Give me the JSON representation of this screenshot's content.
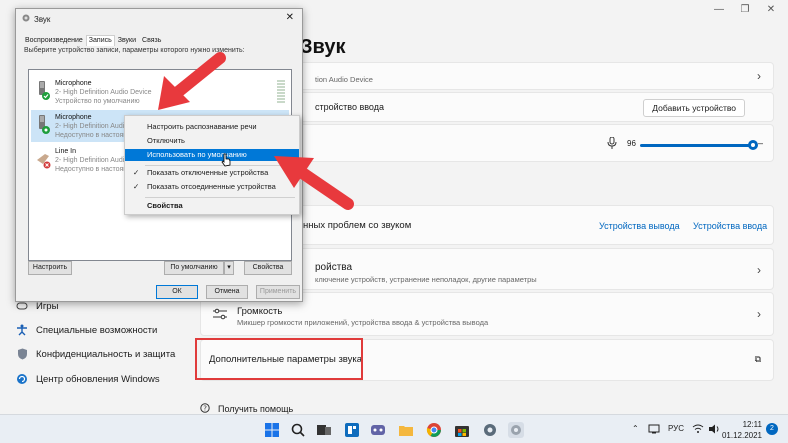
{
  "settings": {
    "title": "Звук",
    "row1": {
      "title_fragment": "",
      "sub": "tion Audio Device"
    },
    "row2": {
      "label": "стройство ввода",
      "button": "Добавить устройство"
    },
    "volume": {
      "value": "96",
      "level": 0.96
    },
    "troubleshoot": {
      "label": "нных проблем со звуком",
      "link_out": "Устройства вывода",
      "link_in": "Устройства ввода"
    },
    "devices": {
      "title": "ройства",
      "sub": "ключение устройств, устранение неполадок, другие параметры"
    },
    "mixer": {
      "title": "Громкость",
      "sub": "Микшер громкости приложений, устройства ввода & устройства вывода"
    },
    "advanced": {
      "label": "Дополнительные параметры звука"
    },
    "help": "Получить помощь",
    "nav": [
      {
        "label": "Игры",
        "icon": "gamepad-icon"
      },
      {
        "label": "Специальные возможности",
        "icon": "accessibility-icon"
      },
      {
        "label": "Конфиденциальность и защита",
        "icon": "shield-icon"
      },
      {
        "label": "Центр обновления Windows",
        "icon": "update-icon"
      }
    ]
  },
  "dialog": {
    "title": "Звук",
    "tabs": [
      "Воспроизведение",
      "Запись",
      "Звуки",
      "Связь"
    ],
    "hint": "Выберите устройство записи, параметры которого нужно изменить:",
    "devices": [
      {
        "name": "Microphone",
        "line2": "2- High Definition Audio Device",
        "line3": "Устройство по умолчанию"
      },
      {
        "name": "Microphone",
        "line2": "2- High Definition Audio Device",
        "line3": "Недоступно в настоящ..."
      },
      {
        "name": "Line In",
        "line2": "2- High Definition Audio Device",
        "line3": "Недоступно в настоящ..."
      }
    ],
    "btn_configure": "Настроить",
    "btn_default": "По умолчанию",
    "btn_properties": "Свойства",
    "btn_ok": "ОК",
    "btn_cancel": "Отмена",
    "btn_apply": "Применить"
  },
  "context_menu": {
    "items": [
      "Настроить распознавание речи",
      "Отключить",
      "Использовать по умолчанию",
      "Показать отключенные устройства",
      "Показать отсоединенные устройства",
      "Свойства"
    ]
  },
  "taskbar": {
    "lang": "РУС",
    "time": "12:11",
    "date": "01.12.2021",
    "notifications": "2"
  },
  "colors": {
    "accent": "#0067c0",
    "highlight": "#e03b3b",
    "menu_select": "#0078d7"
  }
}
